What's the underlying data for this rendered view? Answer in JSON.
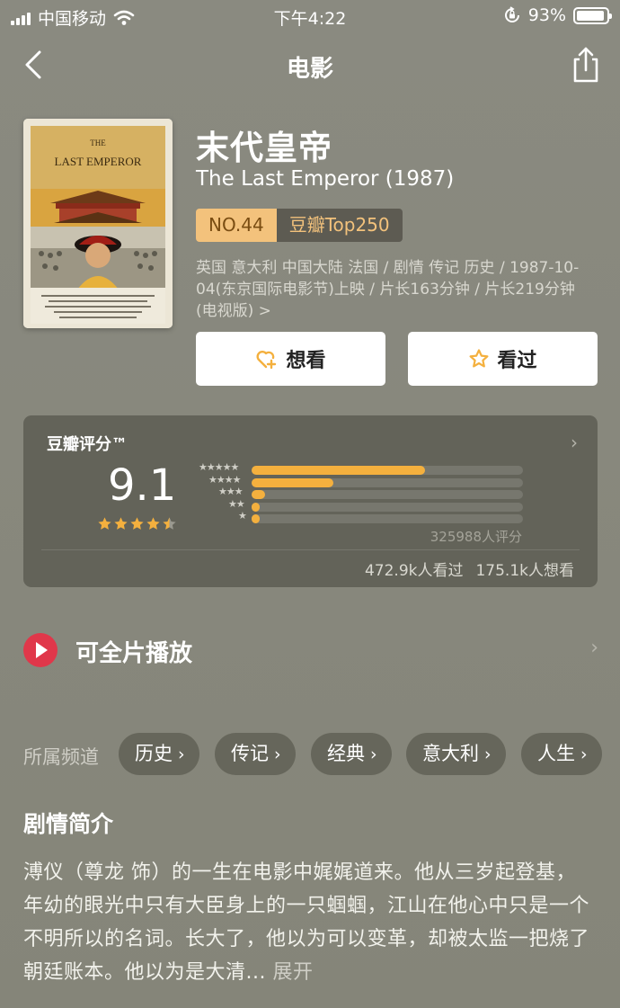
{
  "status_bar": {
    "carrier": "中国移动",
    "time": "下午4:22",
    "battery": "93%",
    "battery_level": 0.93
  },
  "nav": {
    "title": "电影"
  },
  "movie": {
    "title_cn": "末代皇帝",
    "title_en": "The Last Emperor (1987)",
    "rank_no": "NO.44",
    "rank_list": "豆瓣Top250",
    "meta": "英国 意大利 中国大陆 法国 / 剧情 传记 历史 / 1987-10-04(东京国际电影节)上映 / 片长163分钟 / 片长219分钟 (电视版) >",
    "poster_title_line1": "THE",
    "poster_title_line2": "LAST EMPEROR"
  },
  "actions": {
    "want_label": "想看",
    "seen_label": "看过"
  },
  "rating": {
    "label": "豆瓣评分™",
    "score": "9.1",
    "stars": 4.5,
    "distribution": [
      {
        "stars": "★★★★★",
        "fraction": 0.64
      },
      {
        "stars": "★★★★",
        "fraction": 0.3
      },
      {
        "stars": "★★★",
        "fraction": 0.05
      },
      {
        "stars": "★★",
        "fraction": 0.03
      },
      {
        "stars": "★",
        "fraction": 0.03
      }
    ],
    "count": "325988人评分",
    "seen": "472.9k人看过",
    "want": "175.1k人想看"
  },
  "play": {
    "label": "可全片播放"
  },
  "channels": {
    "label": "所属频道",
    "items": [
      "历史",
      "传记",
      "经典",
      "意大利",
      "人生"
    ]
  },
  "synopsis": {
    "title": "剧情简介",
    "text": "溥仪（尊龙 饰）的一生在电影中娓娓道来。他从三岁起登基，年幼的眼光中只有大臣身上的一只蝈蝈，江山在他心中只是一个不明所以的名词。长大了，他以为可以变革，却被太监一把烧了朝廷账本。他以为是大清...",
    "more": "展开"
  },
  "colors": {
    "background": "#87877d",
    "accent_gold": "#f4b03e",
    "play_red": "#e0374a"
  }
}
